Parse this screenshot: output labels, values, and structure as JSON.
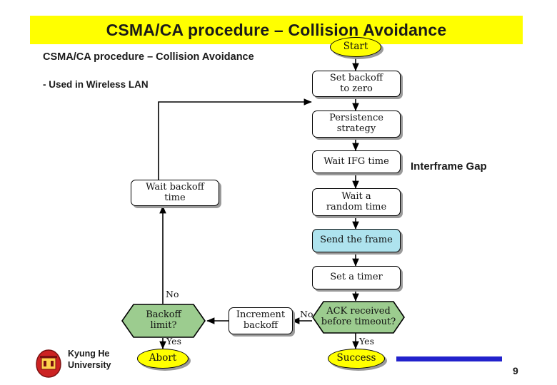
{
  "slide": {
    "title": "CSMA/CA procedure – Collision Avoidance",
    "subtitle": "CSMA/CA procedure – Collision Avoidance",
    "bullet": "- Used in Wireless LAN",
    "side_note": "Interframe Gap",
    "page_number": "9",
    "footer": {
      "university_line1": "Kyung He",
      "university_line2": "University"
    },
    "colors": {
      "title_background": "#ffff00",
      "terminal_fill": "#ffff00",
      "decision_fill": "#9ccc8f",
      "highlight_fill": "#aee3ee",
      "footer_bar": "#2222cc"
    }
  },
  "chart_data": {
    "type": "flowchart",
    "title": "CSMA/CA procedure – Collision Avoidance",
    "nodes": [
      {
        "id": "start",
        "label": "Start",
        "shape": "terminal"
      },
      {
        "id": "backoff0",
        "label": "Set backoff\nto zero",
        "shape": "process"
      },
      {
        "id": "persist",
        "label": "Persistence\nstrategy",
        "shape": "process"
      },
      {
        "id": "ifg",
        "label": "Wait IFG time",
        "shape": "process"
      },
      {
        "id": "randwait",
        "label": "Wait a\nrandom time",
        "shape": "process"
      },
      {
        "id": "send",
        "label": "Send the frame",
        "shape": "process-highlight"
      },
      {
        "id": "timer",
        "label": "Set a timer",
        "shape": "process"
      },
      {
        "id": "ack",
        "label": "ACK received\nbefore timeout?",
        "shape": "decision"
      },
      {
        "id": "increment",
        "label": "Increment\nbackoff",
        "shape": "process"
      },
      {
        "id": "limit",
        "label": "Backoff\nlimit?",
        "shape": "decision"
      },
      {
        "id": "waitback",
        "label": "Wait backoff\ntime",
        "shape": "process"
      },
      {
        "id": "abort",
        "label": "Abort",
        "shape": "terminal"
      },
      {
        "id": "success",
        "label": "Success",
        "shape": "terminal"
      }
    ],
    "edges": [
      {
        "from": "start",
        "to": "backoff0",
        "label": ""
      },
      {
        "from": "backoff0",
        "to": "persist",
        "label": ""
      },
      {
        "from": "persist",
        "to": "ifg",
        "label": ""
      },
      {
        "from": "ifg",
        "to": "randwait",
        "label": ""
      },
      {
        "from": "randwait",
        "to": "send",
        "label": ""
      },
      {
        "from": "send",
        "to": "timer",
        "label": ""
      },
      {
        "from": "timer",
        "to": "ack",
        "label": ""
      },
      {
        "from": "ack",
        "to": "success",
        "label": "Yes"
      },
      {
        "from": "ack",
        "to": "increment",
        "label": "No"
      },
      {
        "from": "increment",
        "to": "limit",
        "label": ""
      },
      {
        "from": "limit",
        "to": "abort",
        "label": "Yes"
      },
      {
        "from": "limit",
        "to": "waitback",
        "label": "No"
      },
      {
        "from": "waitback",
        "to": "persist",
        "label": ""
      }
    ],
    "edge_labels": {
      "ack_no": "No",
      "ack_yes": "Yes",
      "limit_no": "No",
      "limit_yes": "Yes"
    },
    "node_labels": {
      "start": "Start",
      "backoff_zero_l1": "Set backoff",
      "backoff_zero_l2": "to zero",
      "persistence_l1": "Persistence",
      "persistence_l2": "strategy",
      "wait_ifg": "Wait IFG time",
      "wait_random_l1": "Wait a",
      "wait_random_l2": "random time",
      "send_frame": "Send the frame",
      "set_timer": "Set a timer",
      "ack_l1": "ACK received",
      "ack_l2": "before timeout?",
      "increment_l1": "Increment",
      "increment_l2": "backoff",
      "limit_l1": "Backoff",
      "limit_l2": "limit?",
      "wait_backoff_l1": "Wait backoff",
      "wait_backoff_l2": "time",
      "abort": "Abort",
      "success": "Success"
    }
  }
}
